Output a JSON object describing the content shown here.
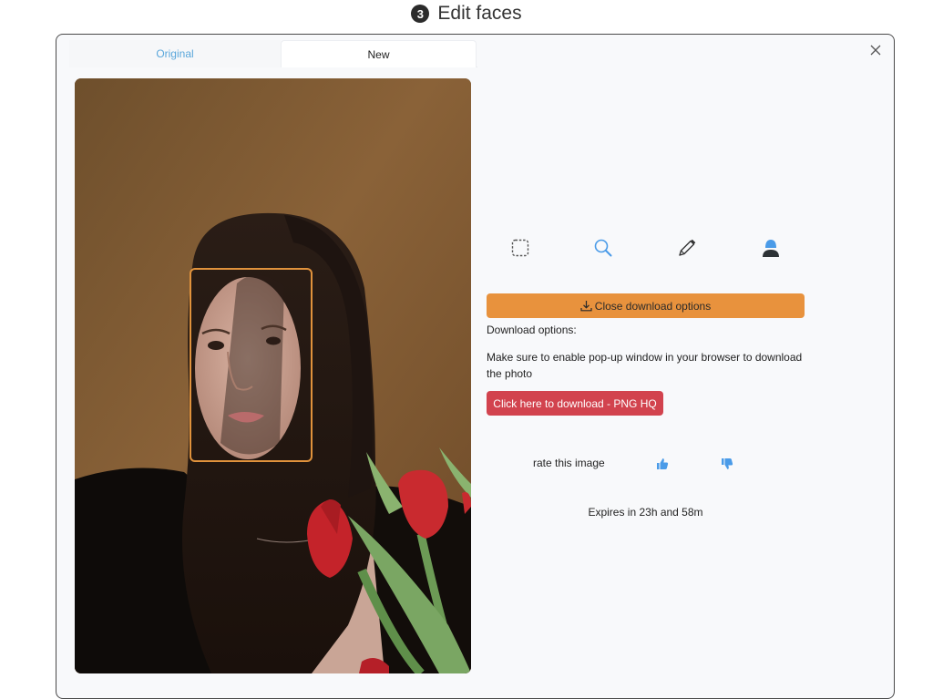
{
  "header": {
    "step_number": "3",
    "title": "Edit faces"
  },
  "tabs": [
    {
      "label": "Original",
      "active": false
    },
    {
      "label": "New",
      "active": true
    }
  ],
  "close_icon": "close-icon",
  "image": {
    "description": "Portrait of a woman with long dark hair holding red tulips against an ochre background",
    "detected_faces": 1
  },
  "toolbar": {
    "tools": [
      {
        "name": "select",
        "icon": "dashed-square-icon"
      },
      {
        "name": "zoom",
        "icon": "magnifier-icon"
      },
      {
        "name": "draw",
        "icon": "pencil-icon"
      },
      {
        "name": "face",
        "icon": "person-icon"
      }
    ]
  },
  "download": {
    "toggle_label": "Close download options",
    "options_label": "Download options:",
    "note": "Make sure to enable pop-up window in your browser to download the photo",
    "download_button_label": "Click here to download - PNG HQ"
  },
  "rating": {
    "label": "rate this image",
    "up_icon": "thumbs-up-icon",
    "down_icon": "thumbs-down-icon"
  },
  "expiry": {
    "text": "Expires in 23h and 58m"
  },
  "colors": {
    "accent_blue": "#4a9be8",
    "orange": "#e8923d",
    "red": "#d2434e",
    "face_box": "#e0923c"
  }
}
